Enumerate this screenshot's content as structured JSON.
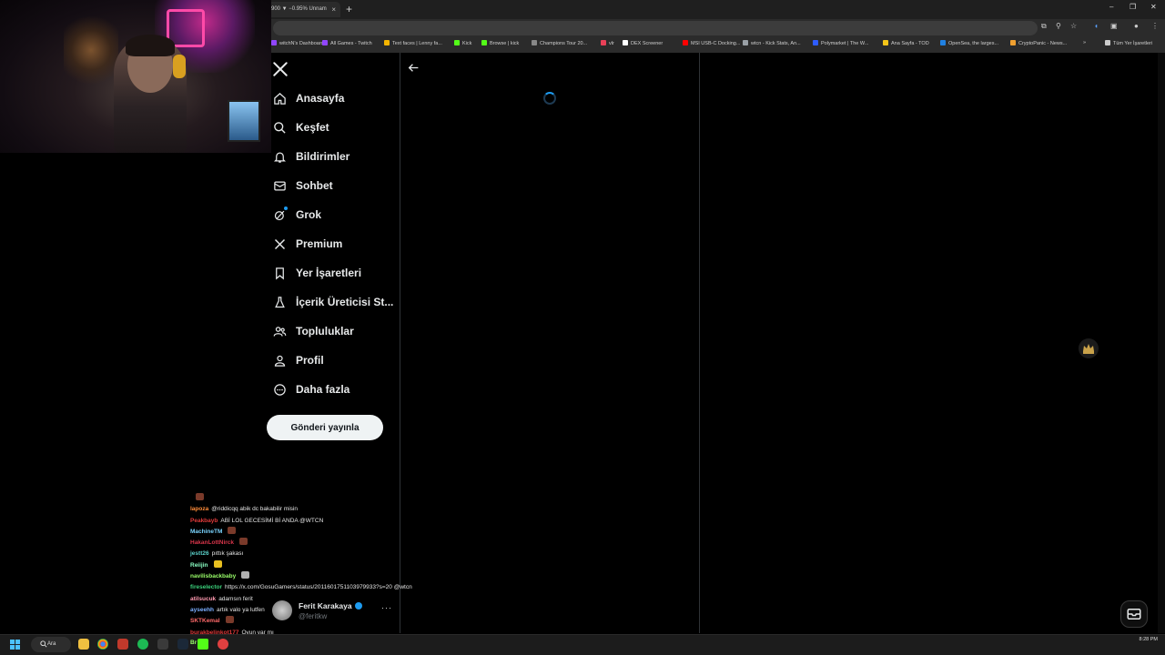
{
  "browser": {
    "active_tab_title": "900 ▼ −0.95% Unnam",
    "tab_close": "×",
    "new_tab": "+",
    "window_controls": [
      "–",
      "❐",
      "✕"
    ],
    "bookmarks": [
      {
        "label": "witchN's Dashboard",
        "color": "#9146ff"
      },
      {
        "label": "All Games - Twitch",
        "color": "#9146ff"
      },
      {
        "label": "Text faces | Lenny fa...",
        "color": "#f4b400"
      },
      {
        "label": "Kick",
        "color": "#53fc18"
      },
      {
        "label": "Browse | kick",
        "color": "#53fc18"
      },
      {
        "label": "Champions Tour 20...",
        "color": "#888888"
      },
      {
        "label": "vlr",
        "color": "#e84057"
      },
      {
        "label": "DEX Screener",
        "color": "#ffffff"
      },
      {
        "label": "MSI USB-C Docking...",
        "color": "#ff0000"
      },
      {
        "label": "wtcn - Kick Stats, An...",
        "color": "#9aa0a6"
      },
      {
        "label": "Polymarket | The W...",
        "color": "#2e5cff"
      },
      {
        "label": "Ana Sayfa - TOD",
        "color": "#f5c518"
      },
      {
        "label": "OpenSea, the larges...",
        "color": "#2081e2"
      },
      {
        "label": "CryptoPanic - News...",
        "color": "#f0a030"
      },
      {
        "label": "»",
        "color": ""
      },
      {
        "label": "Tüm Yer İşaretleri",
        "color": "#cccccc"
      }
    ]
  },
  "sidebar": {
    "items": [
      {
        "label": "Anasayfa",
        "icon": "home-icon"
      },
      {
        "label": "Keşfet",
        "icon": "search-icon"
      },
      {
        "label": "Bildirimler",
        "icon": "bell-icon"
      },
      {
        "label": "Sohbet",
        "icon": "envelope-icon"
      },
      {
        "label": "Grok",
        "icon": "grok-icon"
      },
      {
        "label": "Premium",
        "icon": "x-icon"
      },
      {
        "label": "Yer İşaretleri",
        "icon": "bookmark-icon"
      },
      {
        "label": "İçerik Üreticisi St...",
        "icon": "flask-icon"
      },
      {
        "label": "Topluluklar",
        "icon": "people-icon"
      },
      {
        "label": "Profil",
        "icon": "person-icon"
      },
      {
        "label": "Daha fazla",
        "icon": "more-circle-icon"
      }
    ],
    "post_button": "Gönderi yayınla",
    "account": {
      "name": "Ferit Karakaya",
      "handle": "@feritkw",
      "more": "···"
    }
  },
  "chat": {
    "messages": [
      {
        "user": "",
        "color": "#ff4d4d",
        "text": "",
        "emote": "#7a3a2a"
      },
      {
        "user": "lapoza",
        "color": "#ff8c3a",
        "text": "@riddicqq abik dc bakabilir misin",
        "emote": ""
      },
      {
        "user": "Peakbayb",
        "color": "#e03a3a",
        "text": "ABİ LOL GECESİMİ Bİ ANDA @WTCN",
        "emote": ""
      },
      {
        "user": "MachineTM",
        "color": "#7ad4ff",
        "text": "",
        "emote": "#7a3a2a"
      },
      {
        "user": "HakanLottNirck",
        "color": "#d8354a",
        "text": "",
        "emote": "#7a3a2a"
      },
      {
        "user": "jestt26",
        "color": "#5ad0c8",
        "text": "pıttık şakası",
        "emote": ""
      },
      {
        "user": "Reiijin",
        "color": "#8affc4",
        "text": "",
        "emote": "#e8c020"
      },
      {
        "user": "navilisbackbaby",
        "color": "#9aff6a",
        "text": "",
        "emote": "#b0b0b0"
      },
      {
        "user": "fireselector",
        "color": "#3ad07a",
        "text": "https://x.com/GosuGamers/status/2011601751103979933?s=20 @wtcn",
        "emote": ""
      },
      {
        "user": "atilsucuk",
        "color": "#ff9ab0",
        "text": "adamsın ferit",
        "emote": ""
      },
      {
        "user": "ayseehh",
        "color": "#7aaeff",
        "text": "artık valo ya lutfen",
        "emote": ""
      },
      {
        "user": "SKTKemal",
        "color": "#ff6a6a",
        "text": "",
        "emote": "#7a3a2a"
      },
      {
        "user": "burakbelinkot177",
        "color": "#e03a3a",
        "text": "Oyun var mı",
        "emote": ""
      }
    ]
  },
  "taskbar": {
    "search": "Ara",
    "time": "8:28 PM",
    "overlay_text": "Br"
  },
  "colors": {
    "accent": "#1d9bf0",
    "border": "#2f3336",
    "background": "#000000"
  }
}
